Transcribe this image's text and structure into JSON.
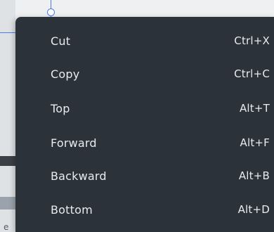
{
  "background": {
    "partial_text": "e"
  },
  "menu": {
    "items": [
      {
        "label": "Cut",
        "shortcut": "Ctrl+X"
      },
      {
        "label": "Copy",
        "shortcut": "Ctrl+C"
      },
      {
        "label": "Top",
        "shortcut": "Alt+T"
      },
      {
        "label": "Forward",
        "shortcut": "Alt+F"
      },
      {
        "label": "Backward",
        "shortcut": "Alt+B"
      },
      {
        "label": "Bottom",
        "shortcut": "Alt+D"
      }
    ]
  },
  "colors": {
    "menu_background": "#2c323a",
    "menu_text": "#e8ebef",
    "selection_accent": "#4a7cf0"
  }
}
